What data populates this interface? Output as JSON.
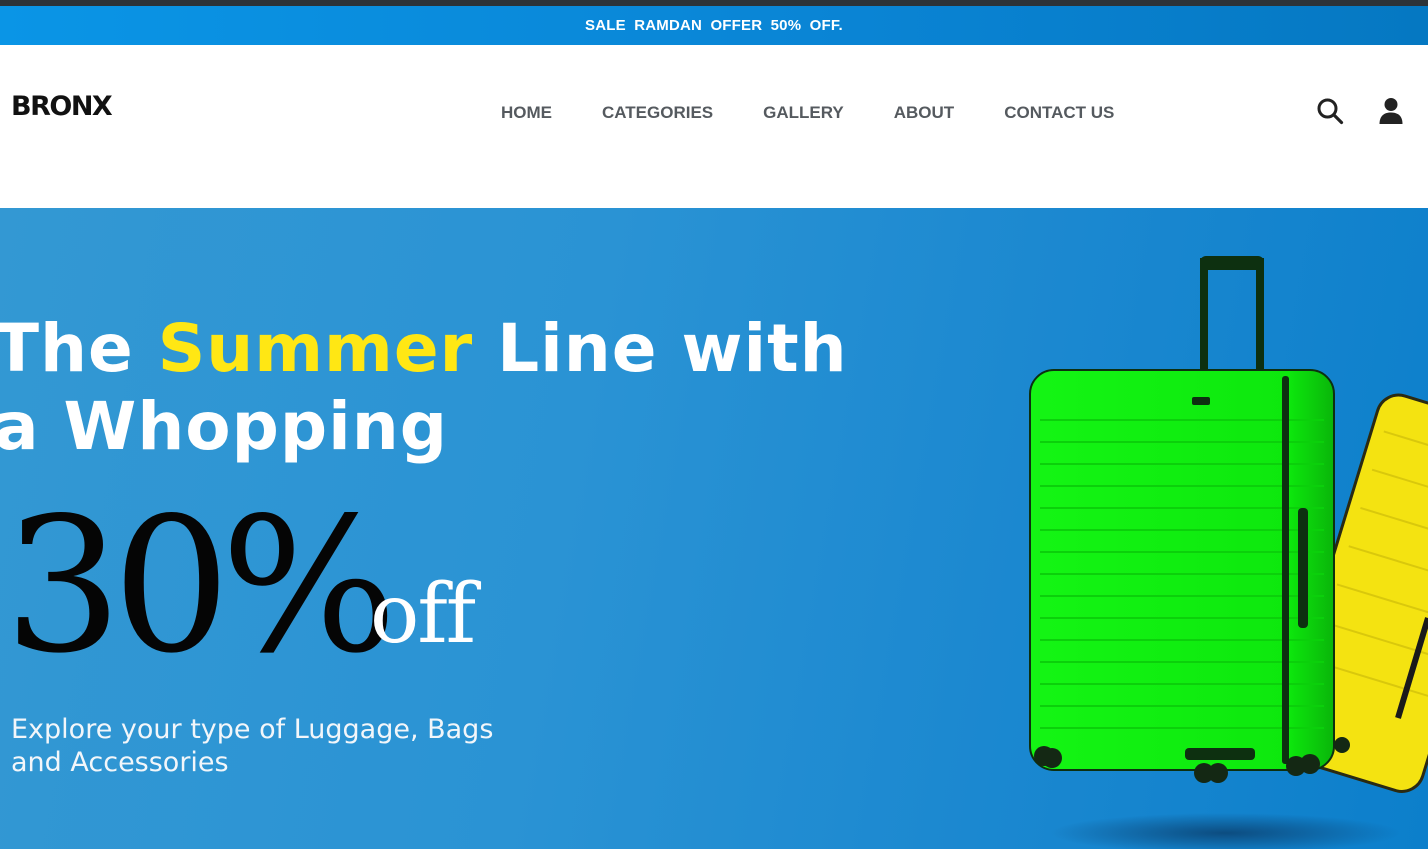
{
  "promo": {
    "text": "SALE RAMDAN OFFER 50% OFF."
  },
  "brand": {
    "name": "BRONX"
  },
  "nav": {
    "items": [
      {
        "label": "HOME"
      },
      {
        "label": "CATEGORIES"
      },
      {
        "label": "GALLERY"
      },
      {
        "label": "ABOUT"
      },
      {
        "label": "CONTACT US"
      }
    ]
  },
  "header_icons": [
    "search-icon",
    "user-icon"
  ],
  "hero": {
    "title_part1": "The ",
    "title_highlight": "Summer",
    "title_part2": " Line with a Whopping",
    "discount_value": "30%",
    "discount_suffix": "off",
    "subtitle": "Explore your type of Luggage, Bags and Accessories",
    "image": "green-and-yellow-suitcases"
  },
  "colors": {
    "promo_bar": "#0a8ad8",
    "hero_background": "#2a93d4",
    "highlight": "#ffe714",
    "nav_text": "#555a5f",
    "suitcase_front": "#0ef20e",
    "suitcase_back": "#f2e10a"
  }
}
